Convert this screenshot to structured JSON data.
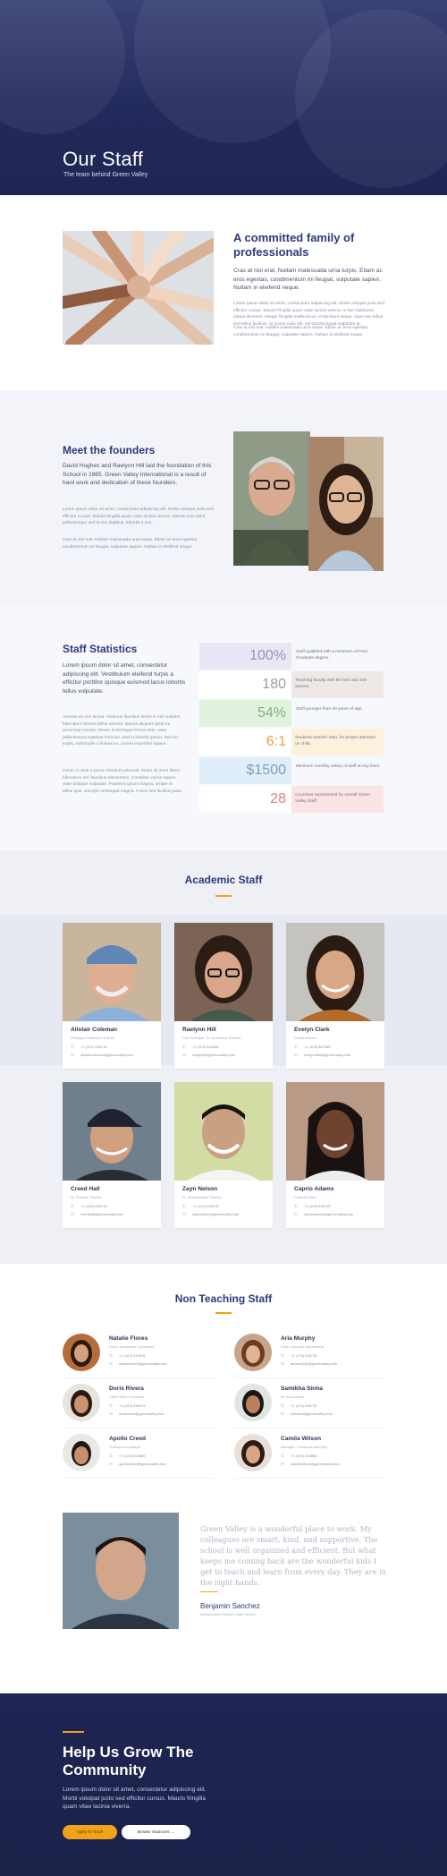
{
  "hero": {
    "title": "Our Staff",
    "subtitle": "The team behind Green Valley"
  },
  "family": {
    "heading": "A committed family of professionals",
    "lead": "Cras at nisl erat. Nullam malesuada urna turpis. Etiam ac eros egestas, condimentum mi feugiat, vulputate sapien. Nullam in eleifend neque.",
    "p2": "Lorem ipsum dolor sit amet, consectetur adipiscing elit. Morbi volutpat justo sed efficitur cursus. Mauris fringilla quam vitae lacinia viverra. In hac habitasse platea dictumst. Integer fringilla mollis lacus, id tincidunt neque. Nam nec tellus sed tellus facilisis. Ut luctus nulla elit, vel lobortis ligula vulputate at.",
    "p3": "Cras at nisl erat. Nullam malesuada urna turpis. Etiam ac eros egestas, condimentum mi feugiat, vulputate sapien. Nullam in eleifend neque."
  },
  "founders": {
    "heading": "Meet the founders",
    "lead": "David Hughes and Raelynn Hill laid the foundation of this School in 1965. Green Valley International is a result of hard work and dedication of these founders.",
    "p2": "Lorem ipsum dolor sit amet, consectetur adipiscing elit. Morbi volutpat justo sed efficitur cursus. Mauris fringilla quam vitae lacinia viverra. Mauris eros dolor, pellentesque sed luctus dapibus, lobortis a orci.",
    "p3": "Cras at nisl erat. Nullam malesuada urna turpis. Etiam ac eros egestas, condimentum mi feugiat, vulputate sapien. Nullam in eleifend neque."
  },
  "stats": {
    "heading": "Staff Statistics",
    "lead": "Lorem ipsum dolor sit amet, consectetur adipiscing elit. Vestibulum eleifend turpis a efficitur porttitor quisque euismod lacus lobortis tellus vulputate.",
    "p2": "Aenean eu orci lectus. Vivamus faucibus lorem in nisl sodales, bibendum lobortis tellus ultrices. Mauris aliquam justo eu accumsan lacinia. Donec scelerisque lectus ante, vitae pellentesque egestas rhoncus. Sed in lobortis ipsum. Sed leo turpis, sollicitudin a finibus eu, ornare imperdiet sapien.",
    "p3": "Donec in ante a purus interdum placerat. Etiam sit amet libero bibendum orci faucibus elementum. Curabitur varius sapien vitae tristique vulputate. Praesent ipsum magna, ornare et tellus quis, suscipit consequat magna. Fusce sed facilisis justo.",
    "items": [
      {
        "value": "100%",
        "label": "Staff qualified with a minimum of Post Graduate degree.",
        "bg": "#ebe6f6",
        "color": "#9a8dbb"
      },
      {
        "value": "180",
        "label": "Teaching faculty with 80 men and 100 women.",
        "bg": "#eee9e6",
        "color": "#a49a93"
      },
      {
        "value": "54%",
        "label": "Staff younger than 40 years of age.",
        "bg": "#e1f2de",
        "color": "#86b07e"
      },
      {
        "value": "6:1",
        "label": "Students teacher ratio, for proper attention on child.",
        "bg": "#fdf1dc",
        "color": "#e7a33a"
      },
      {
        "value": "$1500",
        "label": "Minimum monthly salary of staff at any level.",
        "bg": "#e0eefa",
        "color": "#7e9cb9"
      },
      {
        "value": "28",
        "label": "Countries represented by overall Green Valley Staff.",
        "bg": "#fbe4e5",
        "color": "#e07b7f"
      }
    ]
  },
  "academic": {
    "heading": "Academic Staff",
    "staff": [
      {
        "name": "Alistair Coleman",
        "role": "Principal & Member of BOD",
        "phone": "+1 (123) 246715",
        "email": "alistaircoleman@greenvalley.edu"
      },
      {
        "name": "Raelynn Hill",
        "role": "Vice Principal, Sr. Chemistry Teacher",
        "phone": "+1 (123) 546288",
        "email": "raelynhill@greenvalley.edu"
      },
      {
        "name": "Evelyn Clark",
        "role": "Social Advisor",
        "phone": "+1 (123) 887366",
        "email": "evelynclark@greenvalley.edu"
      },
      {
        "name": "Creed Hall",
        "role": "Sr. Physics Teacher",
        "phone": "+1 (123) 246715",
        "email": "creedhall@greenvalley.edu"
      },
      {
        "name": "Zayn Nelson",
        "role": "Sr. Mathematics Teacher",
        "phone": "+1 (123) 246715",
        "email": "zaynnelson@greenvalley.edu"
      },
      {
        "name": "Caprio Adams",
        "role": "Cultural Head",
        "phone": "+1 (123) 246715",
        "email": "caprioadams@greenvalley.edu"
      }
    ]
  },
  "nonteaching": {
    "heading": "Non Teaching Staff",
    "staff": [
      {
        "name": "Natalie Flores",
        "role": "Head, Admission Committee",
        "phone": "+1 (123) 242876",
        "email": "natalieflores@greenvalley.edu"
      },
      {
        "name": "Aria Murphy",
        "role": "Head, Account Department",
        "phone": "+1 (123) 246715",
        "email": "ariamurphy@greenvalley.edu"
      },
      {
        "name": "Doris Rivera",
        "role": "Chief Office Executive",
        "phone": "+1 (123) 246675",
        "email": "dorisrivera@greenvalley.edu"
      },
      {
        "name": "Samikha Sinha",
        "role": "Sr. Accountant",
        "phone": "+1 (123) 246715",
        "email": "samikha@greenvalley.edu"
      },
      {
        "name": "Apollo Creed",
        "role": "Transport In-charge",
        "phone": "+1 (123) 224866",
        "email": "apollocreed@greenvalley.edu"
      },
      {
        "name": "Camila Wilson",
        "role": "Manager - Financial Aid Dept.",
        "phone": "+1 (123) 254866",
        "email": "camilawilson@greenvalley.edu"
      }
    ]
  },
  "testimonial": {
    "quote": "Green Valley is a wonderful place to work. My colleagues are smart, kind, and supportive. The school is well organized and efficient. But what keeps me coming back are the wonderful kids I get to teach and learn from every day. They are in the right hands.",
    "name": "Benjamin Sanchez",
    "role": "Mathematics Teacher, High School"
  },
  "cta": {
    "heading": "Help Us Grow The Community",
    "text": "Lorem ipsum dolor sit amet, consectetur adipiscing elit. Morbi volutpat justo sed efficitur cursus. Mauris fringilla quam vitae lacinia viverra.",
    "apply": "Apply To Teach",
    "vacancies": "Browse Vacancies  →"
  },
  "colors": {
    "accent": "#f0a21b",
    "navy": "#2e3a7a",
    "hero": "#232a5c"
  }
}
